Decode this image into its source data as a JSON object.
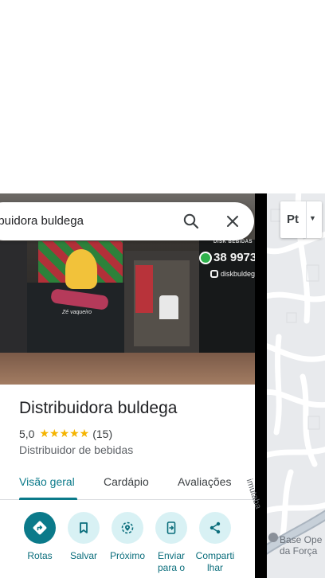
{
  "search": {
    "query": "ibuidora buldega"
  },
  "photo": {
    "mural_text": "Zé vaqueiro",
    "sign_title": "DISK BEBIDAS",
    "phone": "38 99730",
    "instagram": "diskbuldeg"
  },
  "place": {
    "name": "Distribuidora buldega",
    "rating": "5,0",
    "stars": "★★★★★",
    "review_count": "(15)",
    "category": "Distribuidor de bebidas"
  },
  "tabs": [
    {
      "label": "Visão geral",
      "active": true
    },
    {
      "label": "Cardápio",
      "active": false
    },
    {
      "label": "Avaliações",
      "active": false
    }
  ],
  "actions": [
    {
      "label": "Rotas",
      "icon": "directions-icon"
    },
    {
      "label": "Salvar",
      "icon": "bookmark-icon"
    },
    {
      "label": "Próximo",
      "icon": "nearby-icon"
    },
    {
      "label": "Enviar",
      "label2": "para o",
      "icon": "send-to-phone-icon"
    },
    {
      "label": "Comparti",
      "label2": "lhar",
      "icon": "share-icon"
    }
  ],
  "map": {
    "layer_button": "Pt",
    "street_label": "imutaba",
    "poi_line1": "Base Ope",
    "poi_line2": "da Força"
  },
  "colors": {
    "accent": "#0b7a8a",
    "action_bg": "#d8f1f4",
    "star": "#f5b400"
  }
}
